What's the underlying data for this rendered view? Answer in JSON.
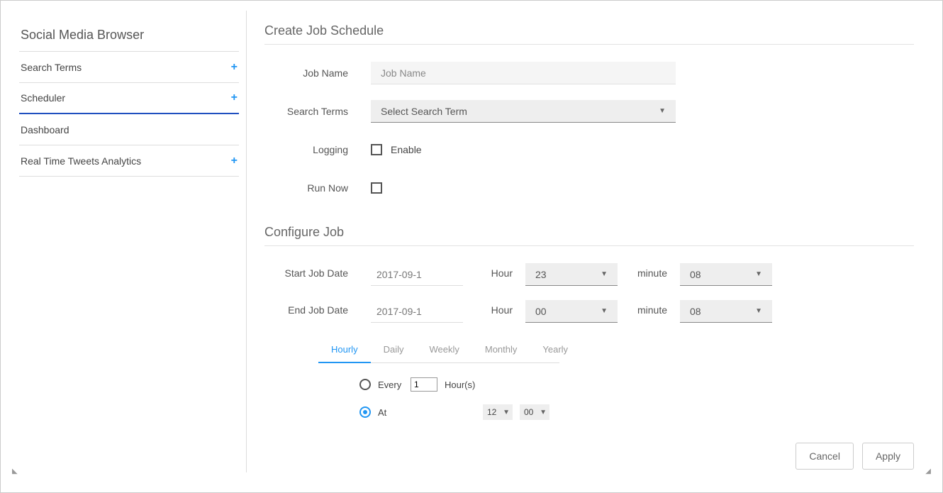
{
  "sidebar": {
    "title": "Social Media Browser",
    "items": [
      {
        "label": "Search Terms",
        "has_plus": true,
        "active": false
      },
      {
        "label": "Scheduler",
        "has_plus": true,
        "active": true
      },
      {
        "label": "Dashboard",
        "has_plus": false,
        "active": false
      },
      {
        "label": "Real Time Tweets Analytics",
        "has_plus": true,
        "active": false
      }
    ]
  },
  "section1": {
    "title": "Create Job Schedule",
    "job_name_label": "Job Name",
    "job_name_placeholder": "Job Name",
    "search_terms_label": "Search Terms",
    "search_terms_value": "Select Search Term",
    "logging_label": "Logging",
    "logging_enable": "Enable",
    "run_now_label": "Run Now"
  },
  "section2": {
    "title": "Configure Job",
    "start_label": "Start Job Date",
    "start_date": "2017-09-1",
    "hour_label": "Hour",
    "start_hour": "23",
    "minute_label": "minute",
    "start_minute": "08",
    "end_label": "End Job Date",
    "end_date": "2017-09-1",
    "end_hour": "00",
    "end_minute": "08",
    "tabs": [
      "Hourly",
      "Daily",
      "Weekly",
      "Monthly",
      "Yearly"
    ],
    "active_tab": "Hourly",
    "recur": {
      "every_label": "Every",
      "every_value": "1",
      "every_unit": "Hour(s)",
      "at_label": "At",
      "at_hour": "12",
      "at_minute": "00",
      "selected": "at"
    }
  },
  "footer": {
    "cancel": "Cancel",
    "apply": "Apply"
  }
}
